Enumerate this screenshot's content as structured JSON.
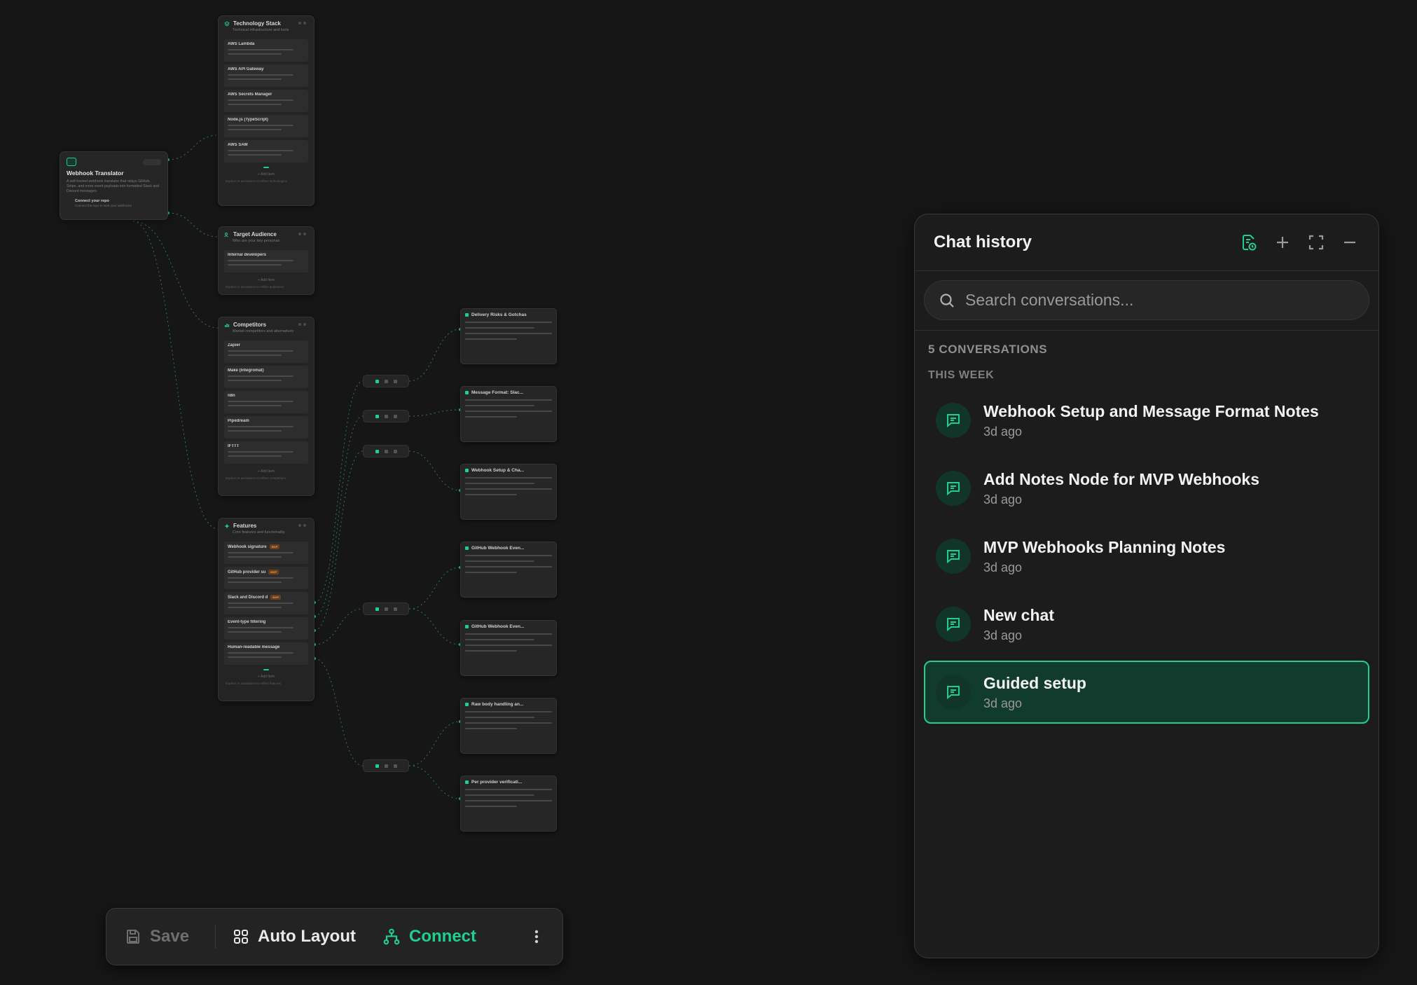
{
  "colors": {
    "accent": "#1fcf8f",
    "background": "#161616",
    "panel": "#1c1c1c",
    "active_item": "#103b2d"
  },
  "canvas": {
    "root_node": {
      "title": "Webhook Translator",
      "description": "A self-hosted webhook translator that relays GitHub, Stripe, and more event payloads into formatted Slack and Discord messages.",
      "connect_title": "Connect your repo",
      "connect_desc": "Connect the repo to start your webhooks"
    },
    "nodes": [
      {
        "title": "Technology Stack",
        "subtitle": "Technical infrastructure and tools",
        "items": [
          {
            "name": "AWS Lambda"
          },
          {
            "name": "AWS API Gateway"
          },
          {
            "name": "AWS Secrets Manager"
          },
          {
            "name": "Node.js (TypeScript)"
          },
          {
            "name": "AWS SAM"
          }
        ],
        "footer": "+ Add Item",
        "note": "Explore AI assistance to reflect technologies"
      },
      {
        "title": "Target Audience",
        "subtitle": "Who are your key personas",
        "items": [
          {
            "name": "Internal developers"
          }
        ],
        "footer": "+ Add Item",
        "note": "Explore AI assistance to reflect audiences"
      },
      {
        "title": "Competitors",
        "subtitle": "Market competitors and alternatives",
        "items": [
          {
            "name": "Zapier"
          },
          {
            "name": "Make (Integromat)"
          },
          {
            "name": "n8n"
          },
          {
            "name": "Pipedream"
          },
          {
            "name": "IFTTT"
          }
        ],
        "footer": "+ Add Item",
        "note": "Explore AI assistance to reflect competitors"
      },
      {
        "title": "Features",
        "subtitle": "Core features and functionality",
        "items": [
          {
            "name": "Webhook signature",
            "tag": "MVP"
          },
          {
            "name": "GitHub provider su",
            "tag": "MVP"
          },
          {
            "name": "Slack and Discord d",
            "tag": "MVP"
          },
          {
            "name": "Event-type filtering"
          },
          {
            "name": "Human-readable message"
          }
        ],
        "footer": "+ Add Item",
        "note": "Explore AI assistance to reflect features"
      }
    ],
    "notes": [
      {
        "title": "Delivery Risks & Gotchas"
      },
      {
        "title": "Message Format: Slac..."
      },
      {
        "title": "Webhook Setup & Cha..."
      },
      {
        "title": "GitHub Webhook Even..."
      },
      {
        "title": "GitHub Webhook Even..."
      },
      {
        "title": "Raw body handling an..."
      },
      {
        "title": "Per provider verificati..."
      }
    ]
  },
  "toolbar": {
    "save": "Save",
    "auto_layout": "Auto Layout",
    "connect": "Connect",
    "more_icon": "more-vertical-icon"
  },
  "chat_history": {
    "title": "Chat history",
    "search_placeholder": "Search conversations...",
    "count_label": "5 CONVERSATIONS",
    "group_label": "THIS WEEK",
    "conversations": [
      {
        "title": "Webhook Setup and Message Format Notes",
        "time": "3d ago",
        "active": false
      },
      {
        "title": "Add Notes Node for MVP Webhooks",
        "time": "3d ago",
        "active": false
      },
      {
        "title": "MVP Webhooks Planning Notes",
        "time": "3d ago",
        "active": false
      },
      {
        "title": "New chat",
        "time": "3d ago",
        "active": false
      },
      {
        "title": "Guided setup",
        "time": "3d ago",
        "active": true
      }
    ]
  }
}
